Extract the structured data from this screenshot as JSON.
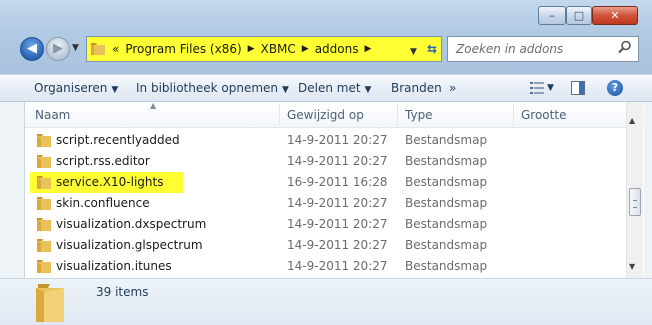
{
  "window": {
    "caption_buttons": {
      "minimize": "–",
      "maximize": "□",
      "close": "✕"
    }
  },
  "navigation": {
    "back_arrow": "◀",
    "forward_arrow": "▶",
    "breadcrumb": {
      "overflow": "«",
      "items": [
        "Program Files (x86)",
        "XBMC",
        "addons"
      ],
      "separator": "▶"
    },
    "search_placeholder": "Zoeken in addons"
  },
  "toolbar": {
    "organize": "Organiseren",
    "include_library": "In bibliotheek opnemen",
    "share": "Delen met",
    "burn": "Branden",
    "more": "»",
    "help": "?"
  },
  "columns": {
    "name": "Naam",
    "modified": "Gewijzigd op",
    "type": "Type",
    "size": "Grootte"
  },
  "files": [
    {
      "name": "script.recentlyadded",
      "modified": "14-9-2011 20:27",
      "type": "Bestandsmap",
      "highlighted": false
    },
    {
      "name": "script.rss.editor",
      "modified": "14-9-2011 20:27",
      "type": "Bestandsmap",
      "highlighted": false
    },
    {
      "name": "service.X10-lights",
      "modified": "16-9-2011 16:28",
      "type": "Bestandsmap",
      "highlighted": true
    },
    {
      "name": "skin.confluence",
      "modified": "14-9-2011 20:27",
      "type": "Bestandsmap",
      "highlighted": false
    },
    {
      "name": "visualization.dxspectrum",
      "modified": "14-9-2011 20:27",
      "type": "Bestandsmap",
      "highlighted": false
    },
    {
      "name": "visualization.glspectrum",
      "modified": "14-9-2011 20:27",
      "type": "Bestandsmap",
      "highlighted": false
    },
    {
      "name": "visualization.itunes",
      "modified": "14-9-2011 20:27",
      "type": "Bestandsmap",
      "highlighted": false
    }
  ],
  "status": {
    "item_count": "39 items"
  },
  "colors": {
    "highlight": "#ffff33",
    "folder": "#e9c35a"
  }
}
